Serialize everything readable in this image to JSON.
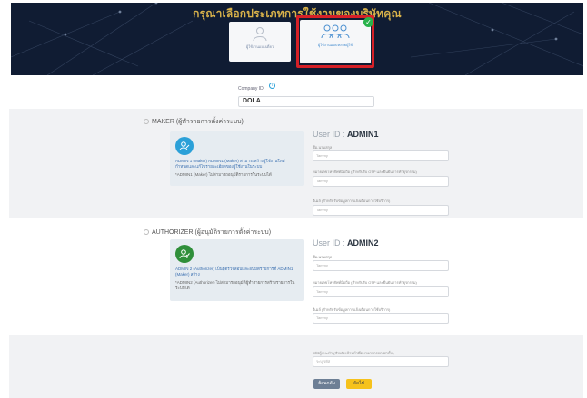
{
  "banner": {
    "title": "กรุณาเลือกประเภทการใช้งานของบริษัทคุณ",
    "cards": [
      {
        "label": "ผู้ใช้งานแบบเดี่ยว",
        "selected": false,
        "icon": "single-user-icon"
      },
      {
        "label": "ผู้ใช้งานแบบหลายผู้ใช้",
        "selected": true,
        "icon": "group-users-icon"
      }
    ],
    "colors": {
      "background": "#101c33",
      "title": "#d9b24a",
      "highlight": "#d62027",
      "check": "#28b24b"
    }
  },
  "company": {
    "label": "Company ID",
    "value": "DOLA"
  },
  "maker": {
    "title": "MAKER (ผู้ทำรายการตั้งค่าระบบ)",
    "description": "ADMIN 1 (Maker) ADMIN1 (Maker) สามารถสร้างผู้ใช้งานใหม่ กำหนดและแก้ไขรายละเอียดของผู้ใช้งานในระบบ",
    "note": "*ADMIN1 (Maker) ไม่สามารถอนุมัติรายการในระบบได้",
    "user_id_label": "User ID :",
    "user_id": "ADMIN1",
    "fields": [
      {
        "label": "ชื่อ-นามสกุล",
        "placeholder": "Tammy"
      },
      {
        "label": "หมายเลขโทรศัพท์มือถือ (สำหรับรับ OTP และยืนยันการทำธุรกรรม)",
        "placeholder": "Tammy"
      },
      {
        "label": "อีเมล์ (สำหรับรับข้อมูลการแจ้งเตือนการใช้บริการ)",
        "placeholder": "Tammy"
      }
    ],
    "avatar_color": "#2aa0d8"
  },
  "authorizer": {
    "title": "AUTHORIZER (ผู้อนุมัติรายการตั้งค่าระบบ)",
    "description": "ADMIN 2 (Authorizer) เป็นผู้ตรวจสอบและอนุมัติรายการที่ ADMIN1 (Maker) สร้าง",
    "note": "*ADMIN2 (Authorizer) ไม่สามารถอนุมัติผู้ทำรายการสร้างรายการในระบบได้",
    "user_id_label": "User ID :",
    "user_id": "ADMIN2",
    "fields": [
      {
        "label": "ชื่อ-นามสกุล",
        "placeholder": "Tammy"
      },
      {
        "label": "หมายเลขโทรศัพท์มือถือ (สำหรับรับ OTP และยืนยันการทำธุรกรรม)",
        "placeholder": "Tammy"
      },
      {
        "label": "อีเมล์ (สำหรับรับข้อมูลการแจ้งเตือนการใช้บริการ)",
        "placeholder": "Tammy"
      }
    ],
    "avatar_color": "#2f8f3a"
  },
  "footer": {
    "field_label": "รหัสผู้แนะนำ (สำหรับเจ้าหน้าที่ธนาคารกรอกเท่านั้น)",
    "field_placeholder": "ระบุ รหัส",
    "back_label": "ย้อนกลับ",
    "next_label": "ถัดไป",
    "colors": {
      "back": "#6d7f95",
      "next": "#f6c21c"
    }
  }
}
